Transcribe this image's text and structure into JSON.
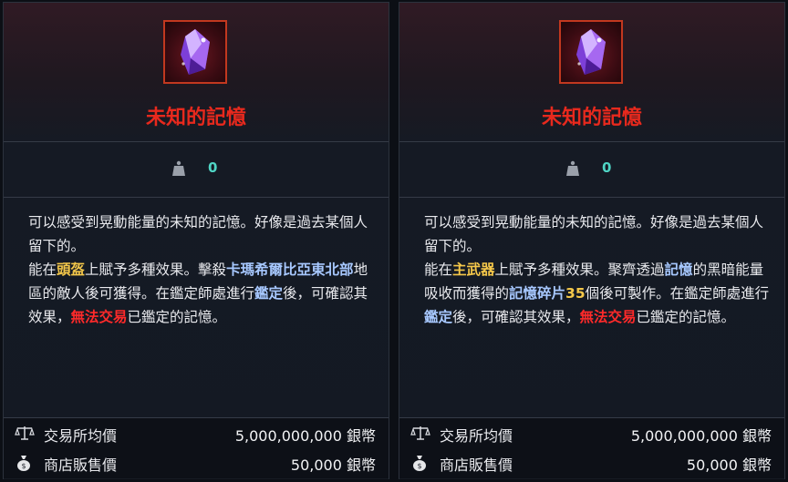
{
  "cards": [
    {
      "title": "未知的記憶",
      "stat_value": "0",
      "description": {
        "line1": "可以感受到晃動能量的未知的記憶。好像是過去某個人留下的。",
        "l2_a": "能在",
        "l2_hl1": "頭盔",
        "l2_b": "上賦予多種效果。擊殺",
        "l2_hl2": "卡瑪希爾比亞東北部",
        "l2_c": "地區的敵人後可獲得。在鑑定師處進行",
        "l2_hl3": "鑑定",
        "l2_d": "後，可確認其效果，",
        "l2_hl4": "無法交易",
        "l2_e": "已鑑定的記憶。"
      },
      "prices": [
        {
          "icon": "scale-icon",
          "label": "交易所均價",
          "value": "5,000,000,000 銀幣"
        },
        {
          "icon": "money-bag-icon",
          "label": "商店販售價",
          "value": "50,000 銀幣"
        }
      ]
    },
    {
      "title": "未知的記憶",
      "stat_value": "0",
      "description": {
        "line1": "可以感受到晃動能量的未知的記憶。好像是過去某個人留下的。",
        "l2_a": "能在",
        "l2_hl1": "主武器",
        "l2_b": "上賦予多種效果。聚齊透過",
        "l2_hl2": "記憶",
        "l2_c": "的黑暗能量吸收而獲得的",
        "l2_hl3": "記憶碎片",
        "l2_hl3b": "35",
        "l2_d": "個後可製作。在鑑定師處進行",
        "l2_hl4": "鑑定",
        "l2_e": "後，可確認其效果，",
        "l2_hl5": "無法交易",
        "l2_f": "已鑑定的記憶。"
      },
      "prices": [
        {
          "icon": "scale-icon",
          "label": "交易所均價",
          "value": "5,000,000,000 銀幣"
        },
        {
          "icon": "money-bag-icon",
          "label": "商店販售價",
          "value": "50,000 銀幣"
        }
      ]
    }
  ],
  "colors": {
    "title": "#e8291d",
    "stat": "#4fd4c4",
    "highlight_yellow": "#f5c84a",
    "highlight_blue": "#a7c8ff",
    "highlight_red": "#ff2a2a"
  }
}
